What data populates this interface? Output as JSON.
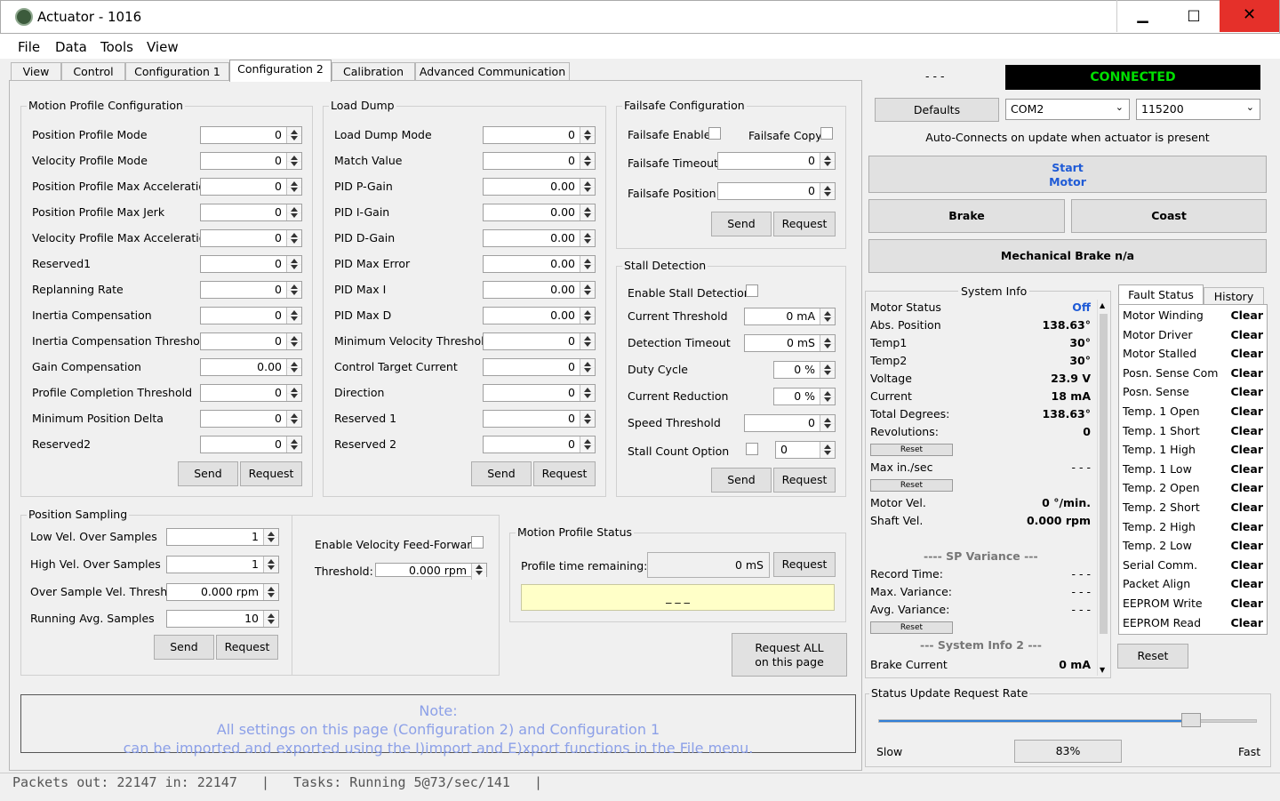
{
  "window": {
    "title": "Actuator - 1016",
    "minimize": "▁",
    "maximize": "□",
    "close": "✕"
  },
  "menu": [
    "File",
    "Data",
    "Tools",
    "View"
  ],
  "tabs": [
    "View",
    "Control",
    "Configuration 1",
    "Configuration 2",
    "Calibration",
    "Advanced Communication"
  ],
  "motion_profile": {
    "title": "Motion Profile Configuration",
    "rows": [
      {
        "label": "Position Profile Mode",
        "value": "0"
      },
      {
        "label": "Velocity Profile Mode",
        "value": "0"
      },
      {
        "label": "Position Profile Max Acceleration",
        "value": "0"
      },
      {
        "label": "Position Profile Max Jerk",
        "value": "0"
      },
      {
        "label": "Velocity Profile Max Acceleration",
        "value": "0"
      },
      {
        "label": "Reserved1",
        "value": "0"
      },
      {
        "label": "Replanning Rate",
        "value": "0"
      },
      {
        "label": "Inertia Compensation",
        "value": "0"
      },
      {
        "label": "Inertia Compensation Threshold",
        "value": "0"
      },
      {
        "label": "Gain Compensation",
        "value": "0.00"
      },
      {
        "label": "Profile Completion Threshold",
        "value": "0"
      },
      {
        "label": "Minimum Position Delta",
        "value": "0"
      },
      {
        "label": "Reserved2",
        "value": "0"
      }
    ],
    "send": "Send",
    "request": "Request"
  },
  "load_dump": {
    "title": "Load Dump",
    "rows": [
      {
        "label": "Load Dump Mode",
        "value": "0"
      },
      {
        "label": "Match Value",
        "value": "0"
      },
      {
        "label": "PID  P-Gain",
        "value": "0.00"
      },
      {
        "label": "PID  I-Gain",
        "value": "0.00"
      },
      {
        "label": "PID  D-Gain",
        "value": "0.00"
      },
      {
        "label": "PID Max Error",
        "value": "0.00"
      },
      {
        "label": "PID Max I",
        "value": "0.00"
      },
      {
        "label": "PID Max D",
        "value": "0.00"
      },
      {
        "label": "Minimum Velocity Threshold",
        "value": "0"
      },
      {
        "label": "Control Target Current",
        "value": "0"
      },
      {
        "label": "Direction",
        "value": "0"
      },
      {
        "label": "Reserved 1",
        "value": "0"
      },
      {
        "label": "Reserved 2",
        "value": "0"
      }
    ],
    "send": "Send",
    "request": "Request"
  },
  "failsafe": {
    "title": "Failsafe Configuration",
    "enable_label": "Failsafe Enable",
    "copy_label": "Failsafe Copy",
    "timeout_label": "Failsafe Timeout",
    "timeout_value": "0",
    "position_label": "Failsafe Position",
    "position_value": "0",
    "send": "Send",
    "request": "Request"
  },
  "stall": {
    "title": "Stall Detection",
    "enable_label": "Enable Stall Detection",
    "rows": [
      {
        "label": "Current Threshold",
        "value": "0 mA"
      },
      {
        "label": "Detection Timeout",
        "value": "0 mS"
      },
      {
        "label": "Duty Cycle",
        "value": "0 %"
      },
      {
        "label": "Current Reduction",
        "value": "0 %"
      },
      {
        "label": "Speed Threshold",
        "value": "0"
      }
    ],
    "count_label": "Stall Count Option",
    "count_value": "0",
    "send": "Send",
    "request": "Request"
  },
  "sampling": {
    "title": "Position Sampling",
    "rows": [
      {
        "label": "Low Vel. Over Samples",
        "value": "1"
      },
      {
        "label": "High Vel. Over Samples",
        "value": "1"
      },
      {
        "label": "Over Sample Vel. Thresh.",
        "value": "0.000 rpm"
      },
      {
        "label": "Running Avg. Samples",
        "value": "10"
      }
    ],
    "ff_label": "Enable Velocity Feed-Forward",
    "threshold_label": "Threshold:",
    "threshold_value": "0.000 rpm",
    "send": "Send",
    "request": "Request"
  },
  "profile_status": {
    "title": "Motion Profile Status",
    "time_label": "Profile time remaining:",
    "time_value": "0 mS",
    "request": "Request",
    "status": "_ _ _"
  },
  "request_all": [
    "Request ALL",
    "on this page"
  ],
  "note": {
    "line1": "Note:",
    "line2": "All settings on this page (Configuration 2) and Configuration 1",
    "line3": "can be imported and exported using the I)import and E)xport functions in the File menu."
  },
  "statusbar": "Packets out: 22147 in: 22147   |   Tasks: Running 5@73/sec/141   |",
  "right": {
    "dashes": "- - -",
    "connected": "CONNECTED",
    "defaults": "Defaults",
    "port": "COM2",
    "baud": "115200",
    "auto_connect": "Auto-Connects on update when actuator is present",
    "start_motor": [
      "Start",
      "Motor"
    ],
    "brake": "Brake",
    "coast": "Coast",
    "mech_brake": "Mechanical Brake n/a"
  },
  "system_info": {
    "title": "System Info",
    "rows": [
      {
        "label": "Motor Status",
        "value": "Off"
      },
      {
        "label": "Abs. Position",
        "value": "138.63°"
      },
      {
        "label": "Temp1",
        "value": "30°"
      },
      {
        "label": "Temp2",
        "value": "30°"
      },
      {
        "label": "Voltage",
        "value": "23.9 V"
      },
      {
        "label": "Current",
        "value": "18 mA"
      },
      {
        "label": "Total Degrees:",
        "value": "138.63°"
      },
      {
        "label": "Revolutions:",
        "value": "0"
      }
    ],
    "reset": "Reset",
    "max_label": "Max in./sec",
    "max_value": "- - -",
    "motor_vel_label": "Motor Vel.",
    "motor_vel_value": "0 °/min.",
    "shaft_vel_label": "Shaft Vel.",
    "shaft_vel_value": "0.000 rpm",
    "sp_header": "---- SP Variance ---",
    "record_label": "Record Time:",
    "record_value": "- - -",
    "maxvar_label": "Max. Variance:",
    "maxvar_value": "- - -",
    "avgvar_label": "Avg. Variance:",
    "avgvar_value": "- - -",
    "si2_header": "--- System Info 2 ---",
    "brake_label": "Brake Current",
    "brake_value": "0 mA"
  },
  "fault": {
    "tab1": "Fault Status",
    "tab2": "History",
    "rows": [
      {
        "label": "Motor Winding",
        "value": "Clear"
      },
      {
        "label": "Motor Driver",
        "value": "Clear"
      },
      {
        "label": "Motor Stalled",
        "value": "Clear"
      },
      {
        "label": "Posn. Sense Com",
        "value": "Clear"
      },
      {
        "label": "Posn. Sense",
        "value": "Clear"
      },
      {
        "label": "Temp. 1 Open",
        "value": "Clear"
      },
      {
        "label": "Temp. 1 Short",
        "value": "Clear"
      },
      {
        "label": "Temp. 1 High",
        "value": "Clear"
      },
      {
        "label": "Temp. 1 Low",
        "value": "Clear"
      },
      {
        "label": "Temp. 2 Open",
        "value": "Clear"
      },
      {
        "label": "Temp. 2 Short",
        "value": "Clear"
      },
      {
        "label": "Temp. 2 High",
        "value": "Clear"
      },
      {
        "label": "Temp. 2 Low",
        "value": "Clear"
      },
      {
        "label": "Serial Comm.",
        "value": "Clear"
      },
      {
        "label": "Packet Align",
        "value": "Clear"
      },
      {
        "label": "EEPROM Write",
        "value": "Clear"
      },
      {
        "label": "EEPROM Read",
        "value": "Clear"
      }
    ],
    "reset": "Reset"
  },
  "update_rate": {
    "title": "Status Update Request Rate",
    "slow": "Slow",
    "fast": "Fast",
    "value": "83%",
    "level": 0.83
  },
  "colors": {
    "connected_bg": "#000000",
    "connected_fg": "#00e000",
    "note_text": "#8ca0e8",
    "motor_off": "#1e5ad6"
  }
}
